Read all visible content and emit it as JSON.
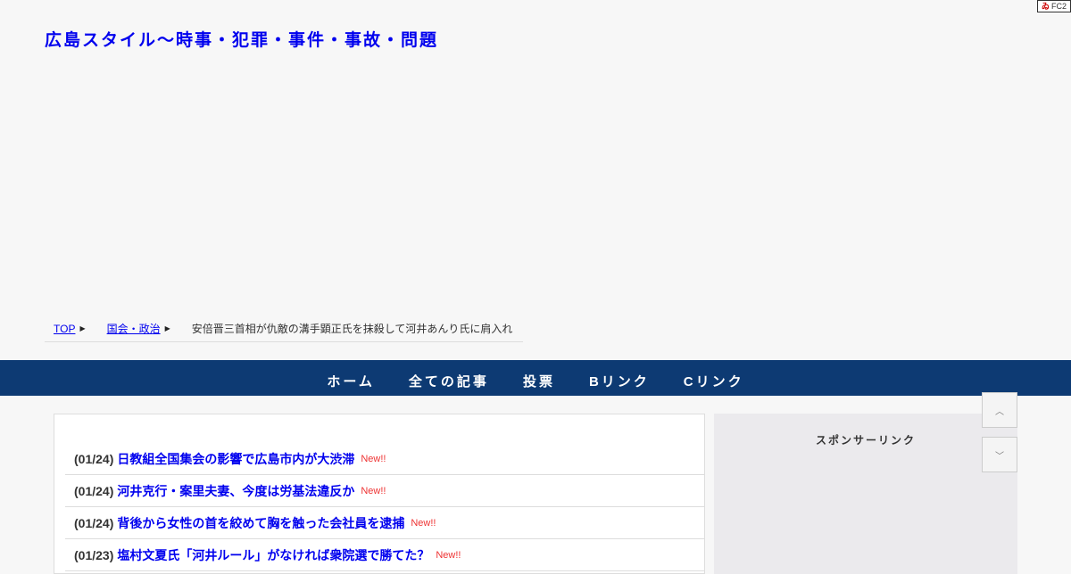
{
  "fc2_badge": {
    "label": "FC2"
  },
  "site": {
    "title": "広島スタイル～時事・犯罪・事件・事故・問題"
  },
  "breadcrumb": {
    "top": "TOP",
    "category": "国会・政治",
    "current": "安倍晋三首相が仇敵の溝手顕正氏を抹殺して河井あんり氏に肩入れ"
  },
  "nav": {
    "items": [
      {
        "label": "ホーム"
      },
      {
        "label": "全ての記事"
      },
      {
        "label": "投票"
      },
      {
        "label": "Bリンク"
      },
      {
        "label": "Cリンク"
      }
    ]
  },
  "news": {
    "items": [
      {
        "date": "(01/24)",
        "title": "日教組全国集会の影響で広島市内が大渋滞",
        "badge": "New!!"
      },
      {
        "date": "(01/24)",
        "title": "河井克行・案里夫妻、今度は労基法違反か",
        "badge": "New!!"
      },
      {
        "date": "(01/24)",
        "title": "背後から女性の首を絞めて胸を触った会社員を逮捕",
        "badge": "New!!"
      },
      {
        "date": "(01/23)",
        "title": "塩村文夏氏「河井ルール」がなければ衆院選で勝てた？",
        "badge": "New!!"
      }
    ]
  },
  "sidebar": {
    "title": "スポンサーリンク"
  },
  "scroll": {
    "up_icon": "chevron-up-icon",
    "down_icon": "chevron-down-icon"
  }
}
